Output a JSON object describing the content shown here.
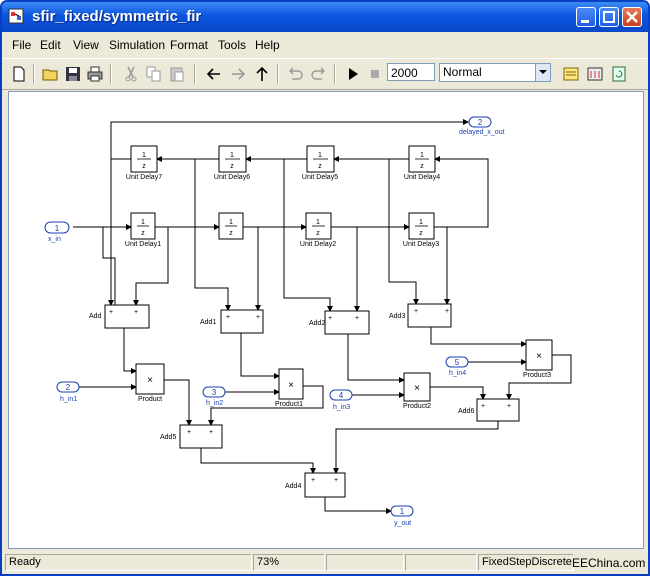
{
  "window": {
    "title": "sfir_fixed/symmetric_fir"
  },
  "menu": {
    "items": [
      "File",
      "Edit",
      "View",
      "Simulation",
      "Format",
      "Tools",
      "Help"
    ]
  },
  "toolbar": {
    "icons": [
      "new-icon",
      "open-icon",
      "save-icon",
      "print-icon",
      "cut-icon",
      "copy-icon",
      "paste-icon",
      "back-icon",
      "forward-icon",
      "up-icon",
      "undo-icon",
      "redo-icon",
      "play-icon",
      "stop-icon",
      "library-browser-icon",
      "model-explorer-icon",
      "refresh-icon"
    ],
    "stop_time": "2000",
    "sim_mode": "Normal"
  },
  "diagram": {
    "ports": {
      "x_in": {
        "number": "1",
        "label": "x_in"
      },
      "h_in1": {
        "number": "2",
        "label": "h_in1"
      },
      "h_in2": {
        "number": "3",
        "label": "h_in2"
      },
      "h_in3": {
        "number": "4",
        "label": "h_in3"
      },
      "h_in4": {
        "number": "5",
        "label": "h_in4"
      },
      "y_out": {
        "number": "1",
        "label": "y_out"
      },
      "delayed_x_out": {
        "number": "2",
        "label": "delayed_x_out"
      }
    },
    "delay_symbol": {
      "num": "1",
      "den": "z"
    },
    "delays": {
      "d1": "Unit Delay1",
      "d2": "Unit Delay2",
      "d3": "Unit Delay3",
      "d4": "Unit Delay4",
      "d5": "Unit Delay5",
      "d6": "Unit Delay6",
      "d7": "Unit Delay7"
    },
    "adds": {
      "add": "Add",
      "add1": "Add1",
      "add2": "Add2",
      "add3": "Add3",
      "add4": "Add4",
      "add5": "Add5",
      "add6": "Add6"
    },
    "products": {
      "p": "Product",
      "p1": "Product1",
      "p2": "Product2",
      "p3": "Product3"
    },
    "plus_sign": "+",
    "times_sign": "×"
  },
  "status": {
    "state": "Ready",
    "zoom": "73%",
    "solver": "FixedStepDiscrete"
  },
  "watermark": "EEChina.com"
}
